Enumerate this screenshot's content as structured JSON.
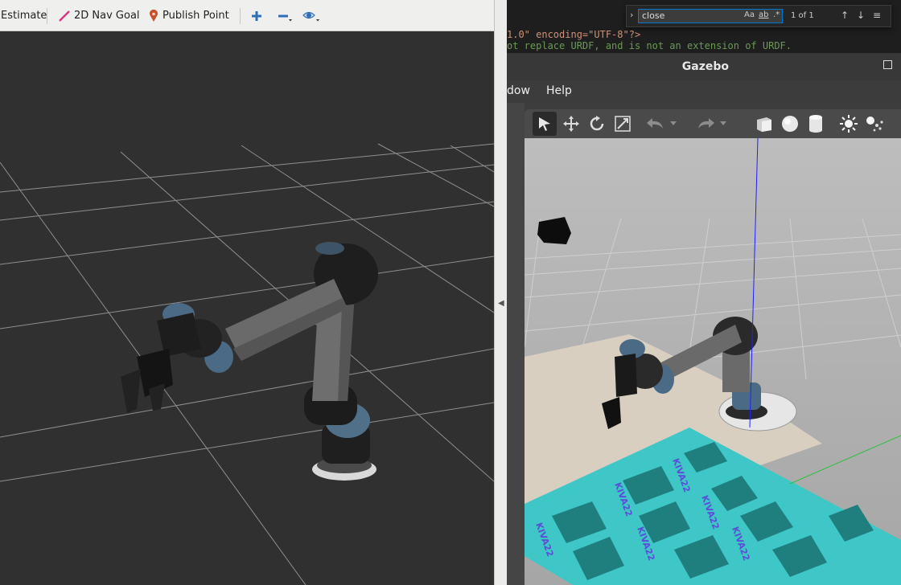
{
  "rviz": {
    "toolbar": {
      "pose_estimate_label": "Estimate",
      "nav_goal_label": "2D Nav Goal",
      "publish_point_label": "Publish Point"
    },
    "colors": {
      "background": "#303030",
      "grid": "#a0a0a0",
      "nav_goal_icon": "#d8347e",
      "publish_point_icon": "#c8502a",
      "tool_icon_blue": "#2d6fb7"
    }
  },
  "editor": {
    "find": {
      "query": "close",
      "match_case": "Aa",
      "whole_word": "ab",
      "regex": ".*",
      "result_count": "1 of 1"
    },
    "code_lines": [
      "1.0\" encoding=\"UTF-8\"?>",
      "ot replace URDF, and is not an extension of URDF."
    ]
  },
  "gazebo": {
    "window_title": "Gazebo",
    "menu": {
      "window_label": "dow",
      "help_label": "Help"
    },
    "toolbar_icons": [
      "select-arrow-icon",
      "translate-icon",
      "rotate-icon",
      "scale-icon",
      "undo-icon",
      "redo-icon",
      "box-shape-icon",
      "sphere-shape-icon",
      "cylinder-shape-icon",
      "point-light-icon",
      "spot-light-icon"
    ],
    "tray_label": "KIVA22",
    "colors": {
      "ground": "#8f8f8f",
      "table": "#d8cfc1",
      "tray": "#3fc6c6",
      "tray_slot": "#1f7e7e",
      "tray_label": "#5a4fd8",
      "z_axis": "#2020ff"
    }
  }
}
